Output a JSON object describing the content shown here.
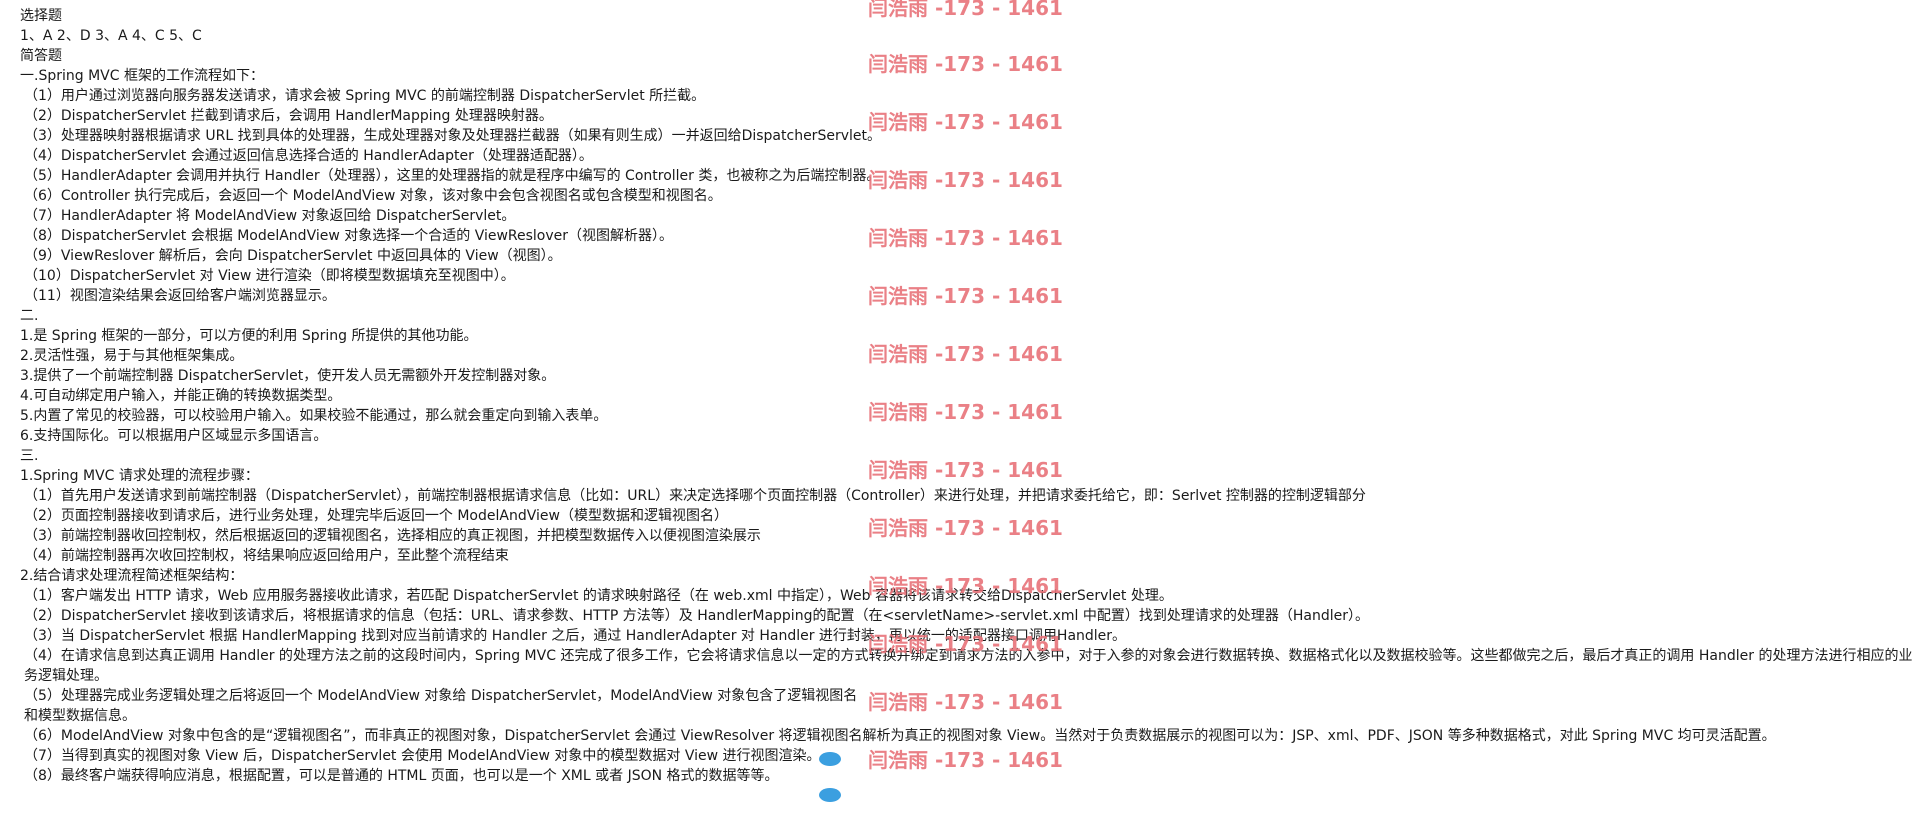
{
  "lines": [
    {
      "text": "选择题",
      "indent": false
    },
    {
      "text": "1、A 2、D 3、A 4、C 5、C",
      "indent": false
    },
    {
      "text": "简答题",
      "indent": false
    },
    {
      "text": "一.Spring MVC 框架的工作流程如下：",
      "indent": false
    },
    {
      "text": "（1）用户通过浏览器向服务器发送请求，请求会被 Spring MVC 的前端控制器 DispatcherServlet 所拦截。",
      "indent": true
    },
    {
      "text": "（2）DispatcherServlet 拦截到请求后，会调用 HandlerMapping 处理器映射器。",
      "indent": true
    },
    {
      "text": "（3）处理器映射器根据请求 URL 找到具体的处理器，生成处理器对象及处理器拦截器（如果有则生成）一并返回给DispatcherServlet。",
      "indent": true
    },
    {
      "text": "（4）DispatcherServlet 会通过返回信息选择合适的 HandlerAdapter（处理器适配器）。",
      "indent": true
    },
    {
      "text": "（5）HandlerAdapter 会调用并执行 Handler（处理器），这里的处理器指的就是程序中编写的 Controller 类，也被称之为后端控制器。",
      "indent": true
    },
    {
      "text": "（6）Controller 执行完成后，会返回一个 ModelAndView 对象，该对象中会包含视图名或包含模型和视图名。",
      "indent": true
    },
    {
      "text": "（7）HandlerAdapter 将 ModelAndView 对象返回给 DispatcherServlet。",
      "indent": true
    },
    {
      "text": "（8）DispatcherServlet 会根据 ModelAndView 对象选择一个合适的 ViewReslover（视图解析器）。",
      "indent": true
    },
    {
      "text": "（9）ViewReslover 解析后，会向 DispatcherServlet 中返回具体的 View（视图）。",
      "indent": true
    },
    {
      "text": "（10）DispatcherServlet 对 View 进行渲染（即将模型数据填充至视图中）。",
      "indent": true
    },
    {
      "text": "（11）视图渲染结果会返回给客户端浏览器显示。",
      "indent": true
    },
    {
      "text": "二.",
      "indent": false
    },
    {
      "text": "1.是 Spring 框架的一部分，可以方便的利用 Spring 所提供的其他功能。",
      "indent": false
    },
    {
      "text": "2.灵活性强，易于与其他框架集成。",
      "indent": false
    },
    {
      "text": "3.提供了一个前端控制器 DispatcherServlet，使开发人员无需额外开发控制器对象。",
      "indent": false
    },
    {
      "text": "4.可自动绑定用户输入，并能正确的转换数据类型。",
      "indent": false
    },
    {
      "text": "5.内置了常见的校验器，可以校验用户输入。如果校验不能通过，那么就会重定向到输入表单。",
      "indent": false
    },
    {
      "text": "6.支持国际化。可以根据用户区域显示多国语言。",
      "indent": false
    },
    {
      "text": "三.",
      "indent": false
    },
    {
      "text": "1.Spring MVC 请求处理的流程步骤：",
      "indent": false
    },
    {
      "text": "（1）首先用户发送请求到前端控制器（DispatcherServlet），前端控制器根据请求信息（比如：URL）来决定选择哪个页面控制器（Controller）来进行处理，并把请求委托给它，即：Serlvet 控制器的控制逻辑部分",
      "indent": true
    },
    {
      "text": "（2）页面控制器接收到请求后，进行业务处理，处理完毕后返回一个 ModelAndView（模型数据和逻辑视图名）",
      "indent": true
    },
    {
      "text": "（3）前端控制器收回控制权，然后根据返回的逻辑视图名，选择相应的真正视图，并把模型数据传入以便视图渲染展示",
      "indent": true
    },
    {
      "text": "（4）前端控制器再次收回控制权，将结果响应返回给用户，至此整个流程结束",
      "indent": true
    },
    {
      "text": "2.结合请求处理流程简述框架结构：",
      "indent": false
    },
    {
      "text": "（1）客户端发出 HTTP 请求，Web 应用服务器接收此请求，若匹配 DispatcherServlet 的请求映射路径（在 web.xml 中指定），Web 容器将该请求转交给DispatcherServlet 处理。",
      "indent": true
    },
    {
      "text": "（2）DispatcherServlet 接收到该请求后，将根据请求的信息（包括：URL、请求参数、HTTP 方法等）及 HandlerMapping的配置（在<servletName>-servlet.xml 中配置）找到处理请求的处理器（Handler）。",
      "indent": true
    },
    {
      "text": "（3）当 DispatcherServlet 根据 HandlerMapping 找到对应当前请求的 Handler 之后，通过 HandlerAdapter 对 Handler 进行封装，再以统一的适配器接口调用Handler。",
      "indent": true
    },
    {
      "text": "（4）在请求信息到达真正调用 Handler 的处理方法之前的这段时间内，Spring MVC 还完成了很多工作，它会将请求信息以一定的方式转换并绑定到请求方法的入参中，对于入参的对象会进行数据转换、数据格式化以及数据校验等。这些都做完之后，最后才真正的调用 Handler 的处理方法进行相应的业务逻辑处理。",
      "indent": true,
      "wrap": true
    },
    {
      "text": "（5）处理器完成业务逻辑处理之后将返回一个 ModelAndView 对象给 DispatcherServlet，ModelAndView 对象包含了逻辑视图名和模型数据信息。",
      "indent": true,
      "wrap": true,
      "narrow": true
    },
    {
      "text": "（6）ModelAndView 对象中包含的是“逻辑视图名”，而非真正的视图对象，DispatcherServlet 会通过 ViewResolver 将逻辑视图名解析为真正的视图对象 View。当然对于负责数据展示的视图可以为：JSP、xml、PDF、JSON 等多种数据格式，对此 Spring MVC 均可灵活配置。",
      "indent": true
    },
    {
      "text": "（7）当得到真实的视图对象 View 后，DispatcherServlet 会使用 ModelAndView 对象中的模型数据对 View 进行视图渲染。",
      "indent": true
    },
    {
      "text": "（8）最终客户端获得响应消息，根据配置，可以是普通的 HTML 页面，也可以是一个 XML 或者 JSON 格式的数据等等。",
      "indent": true
    }
  ],
  "watermark": {
    "text": "闫浩雨 -173 - 1461",
    "color": "#e8737a"
  }
}
